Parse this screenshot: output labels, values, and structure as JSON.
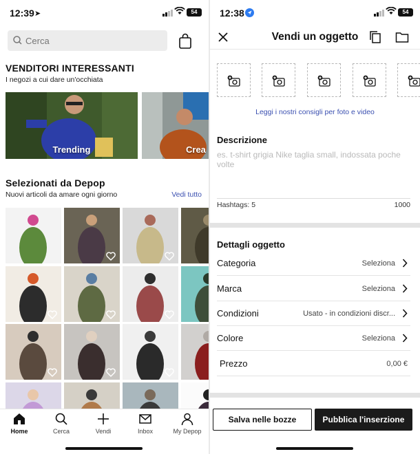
{
  "left": {
    "status": {
      "time": "12:39",
      "battery": "54"
    },
    "search": {
      "placeholder": "Cerca"
    },
    "sellers": {
      "title": "VENDITORI INTERESSANTI",
      "subtitle": "I negozi a cui dare un'occhiata",
      "cards": [
        {
          "label": "Trending"
        },
        {
          "label": "Crea"
        }
      ]
    },
    "picked": {
      "title": "Selezionati da Depop",
      "subtitle": "Nuovi articoli da amare ogni giorno",
      "see_all": "Vedi tutto"
    },
    "tabs": [
      {
        "label": "Home",
        "icon": "home-icon",
        "active": true
      },
      {
        "label": "Cerca",
        "icon": "search-icon",
        "active": false
      },
      {
        "label": "Vendi",
        "icon": "plus-icon",
        "active": false
      },
      {
        "label": "Inbox",
        "icon": "mail-icon",
        "active": false
      },
      {
        "label": "My Depop",
        "icon": "profile-icon",
        "active": false
      }
    ]
  },
  "right": {
    "status": {
      "time": "12:38",
      "battery": "54"
    },
    "header": {
      "title": "Vendi un oggetto"
    },
    "photo_tips": "Leggi i nostri consigli per foto e video",
    "description": {
      "label": "Descrizione",
      "placeholder": "es. t-shirt grigia Nike taglia small, indossata poche volte",
      "hashtags": "Hashtags: 5",
      "char_limit": "1000"
    },
    "details": {
      "label": "Dettagli oggetto",
      "rows": [
        {
          "key": "Categoria",
          "value": "Seleziona"
        },
        {
          "key": "Marca",
          "value": "Seleziona"
        },
        {
          "key": "Condizioni",
          "value": "Usato - in condizioni discr..."
        },
        {
          "key": "Colore",
          "value": "Seleziona"
        },
        {
          "key": "Prezzo",
          "value": "0,00 €"
        }
      ]
    },
    "buttons": {
      "draft": "Salva nelle bozze",
      "publish": "Pubblica l'inserzione"
    }
  },
  "colors": {
    "link": "#3a4fb0",
    "dark_button": "#1b1b1b",
    "band": "#e3e3e3"
  }
}
